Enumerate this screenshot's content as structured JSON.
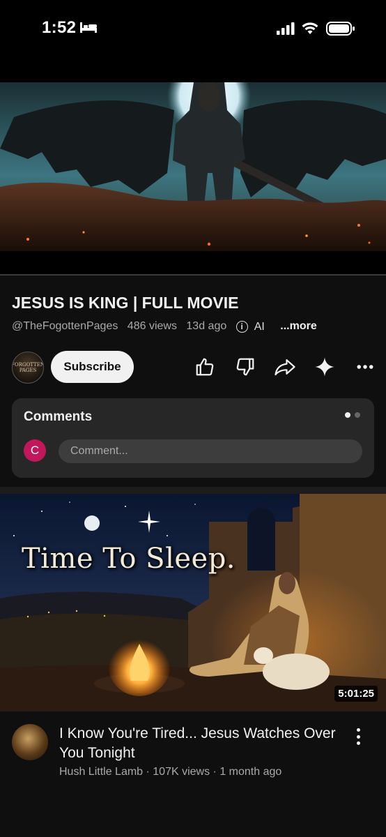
{
  "status_bar": {
    "time": "1:52",
    "icons": [
      "bed-icon",
      "cellular-signal-icon",
      "wifi-icon",
      "battery-icon"
    ]
  },
  "video": {
    "title": "JESUS IS KING | FULL MOVIE",
    "channel_handle": "@TheFogottenPages",
    "views": "486 views",
    "age": "13d ago",
    "ai_label": "AI",
    "more_label": "...more",
    "channel_avatar_text": [
      "FORGOTTEN",
      "PAGES"
    ],
    "subscribe_label": "Subscribe",
    "actions": [
      "like-icon",
      "dislike-icon",
      "share-icon",
      "sparkle-icon",
      "more-options-icon"
    ]
  },
  "comments": {
    "title": "Comments",
    "user_initial": "C",
    "placeholder": "Comment...",
    "page_dots": 2,
    "active_dot": 0
  },
  "recommended": {
    "thumbnail_text": "Time To Sleep.",
    "duration": "5:01:25",
    "title": "I Know You're Tired... Jesus Watches Over You Tonight",
    "meta": "Hush Little Lamb · 107K views · 1 month ago"
  },
  "colors": {
    "background": "#0f0f0f",
    "card": "#272727",
    "subscribe_bg": "#f1f1f1",
    "avatar_c": "#c2185b",
    "secondary_text": "#aaaaaa"
  }
}
